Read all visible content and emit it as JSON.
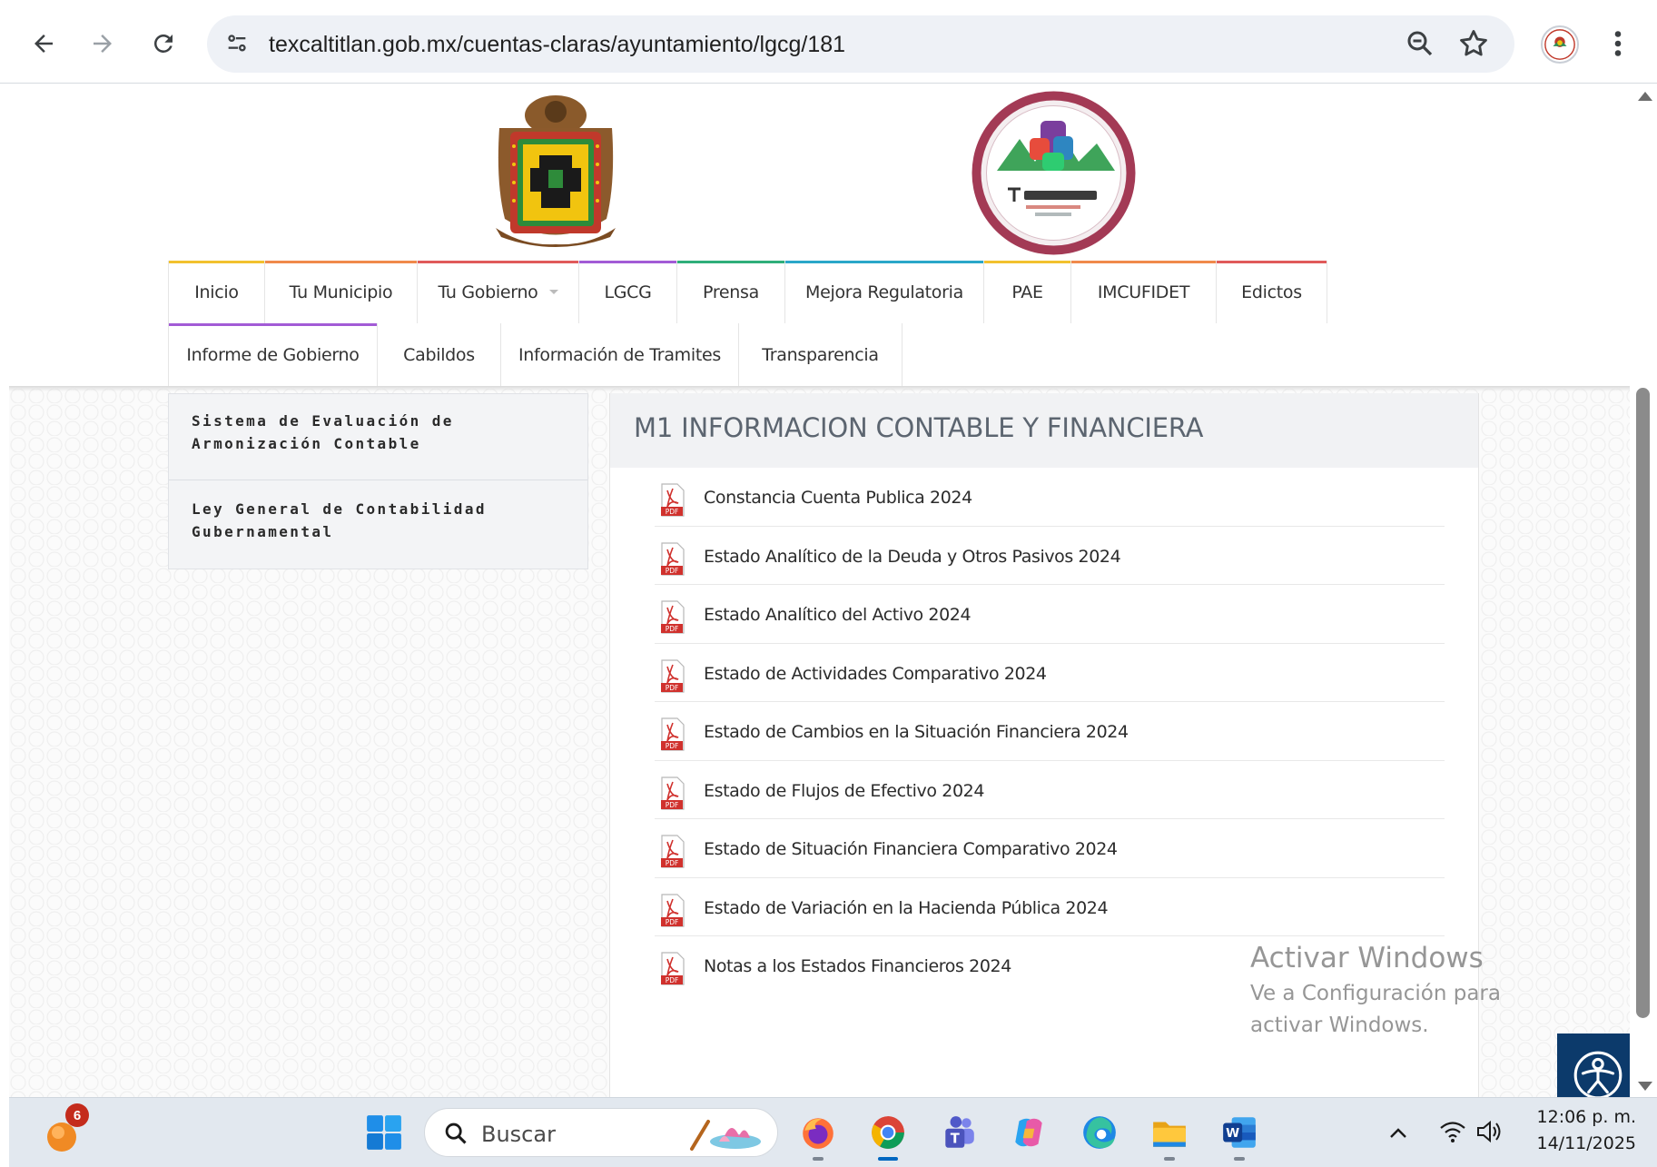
{
  "browser": {
    "url": "texcaltitlan.gob.mx/cuentas-claras/ayuntamiento/lgcg/181"
  },
  "nav": {
    "row1": [
      {
        "label": "Inicio",
        "color": "#f2c12e"
      },
      {
        "label": "Tu Municipio",
        "color": "#f08a4b"
      },
      {
        "label": "Tu Gobierno",
        "color": "#e05a5a",
        "dropdown": true
      },
      {
        "label": "LGCG",
        "color": "#a25bd6"
      },
      {
        "label": "Prensa",
        "color": "#2fae7a"
      },
      {
        "label": "Mejora Regulatoria",
        "color": "#2aa7c9"
      },
      {
        "label": "PAE",
        "color": "#f2c12e"
      },
      {
        "label": "IMCUFIDET",
        "color": "#f08a4b"
      },
      {
        "label": "Edictos",
        "color": "#e05a5a"
      }
    ],
    "row2": [
      {
        "label": "Informe de Gobierno",
        "color": "#a25bd6"
      },
      {
        "label": "Cabildos",
        "color": ""
      },
      {
        "label": "Información de Tramites",
        "color": ""
      },
      {
        "label": "Transparencia",
        "color": ""
      }
    ]
  },
  "sidebar": {
    "items": [
      {
        "label": "Sistema de Evaluación de Armonización Contable"
      },
      {
        "label": "Ley General de Contabilidad Gubernamental"
      }
    ]
  },
  "main": {
    "title": "M1 INFORMACION CONTABLE Y FINANCIERA",
    "documents": [
      {
        "label": "Constancia Cuenta Publica 2024"
      },
      {
        "label": "Estado Analítico de la Deuda y Otros Pasivos 2024"
      },
      {
        "label": "Estado Analítico del Activo 2024"
      },
      {
        "label": "Estado de Actividades Comparativo 2024"
      },
      {
        "label": "Estado de Cambios en la Situación Financiera 2024"
      },
      {
        "label": "Estado de Flujos de Efectivo 2024"
      },
      {
        "label": "Estado de Situación Financiera Comparativo 2024"
      },
      {
        "label": "Estado de Variación en la Hacienda Pública 2024"
      },
      {
        "label": "Notas a los Estados Financieros 2024"
      }
    ]
  },
  "watermark": {
    "title": "Activar Windows",
    "subtitle": "Ve a Configuración para activar Windows."
  },
  "taskbar": {
    "weather_badge": "6",
    "search_placeholder": "Buscar",
    "clock_time": "12:06 p. m.",
    "clock_date": "14/11/2025",
    "apps": [
      "start",
      "firefox",
      "chrome",
      "teams",
      "copilot",
      "edge",
      "file-explorer",
      "word"
    ]
  },
  "colors": {
    "accessibility_button": "#0c3a6b",
    "pdf_red": "#d0312d"
  }
}
